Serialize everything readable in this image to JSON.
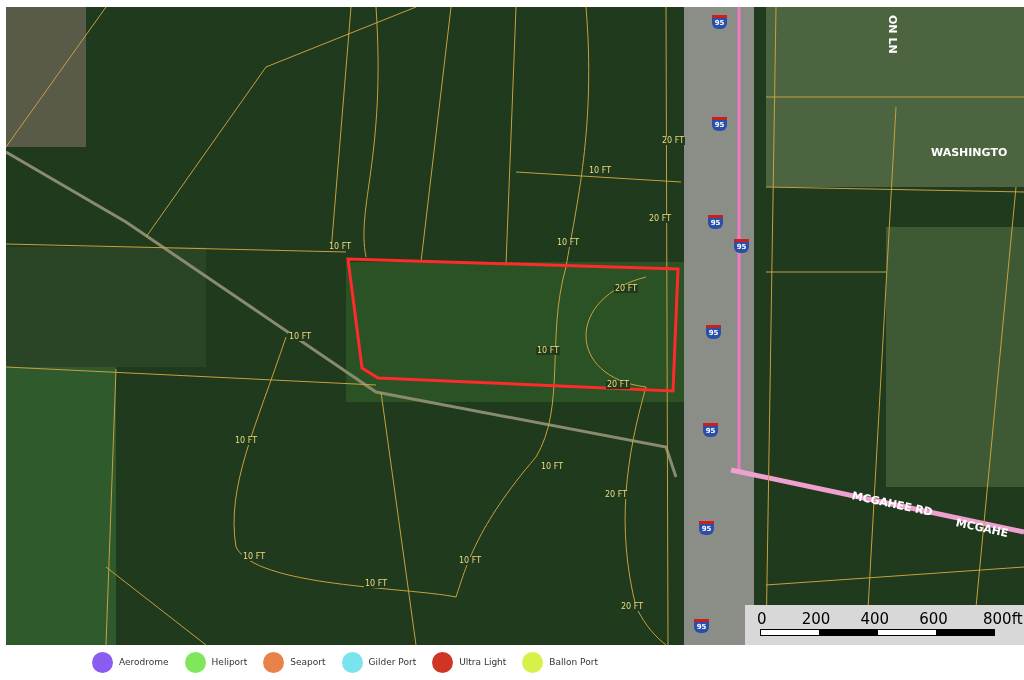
{
  "map": {
    "street_labels": [
      {
        "text": "ON LN",
        "kind": "vertical"
      },
      {
        "text": "WASHINGTO",
        "kind": "horizontal"
      },
      {
        "text": "MCGAHEE RD",
        "kind": "slanted"
      },
      {
        "text": "MCGAHE",
        "kind": "slanted"
      }
    ],
    "highway_shields": [
      "95",
      "95",
      "95",
      "95",
      "95",
      "95",
      "95",
      "95"
    ],
    "contour_labels": [
      "10 FT",
      "20 FT",
      "20 FT",
      "10 FT",
      "20 FT",
      "10 FT",
      "10 FT",
      "10 FT",
      "20 FT",
      "20 FT",
      "10 FT",
      "10 FT",
      "10 FT",
      "10 FT",
      "20 FT",
      "10 FT"
    ]
  },
  "scale_bar": {
    "ticks": [
      "0",
      "200",
      "400",
      "600",
      "800ft"
    ]
  },
  "legend": [
    {
      "label": "Aerodrome",
      "color": "#8a5cf0"
    },
    {
      "label": "Heliport",
      "color": "#7ee85a"
    },
    {
      "label": "Seaport",
      "color": "#e8824a"
    },
    {
      "label": "Gilder Port",
      "color": "#7ae4ec"
    },
    {
      "label": "Ultra Light",
      "color": "#d03424"
    },
    {
      "label": "Ballon Port",
      "color": "#d8f04a"
    }
  ]
}
